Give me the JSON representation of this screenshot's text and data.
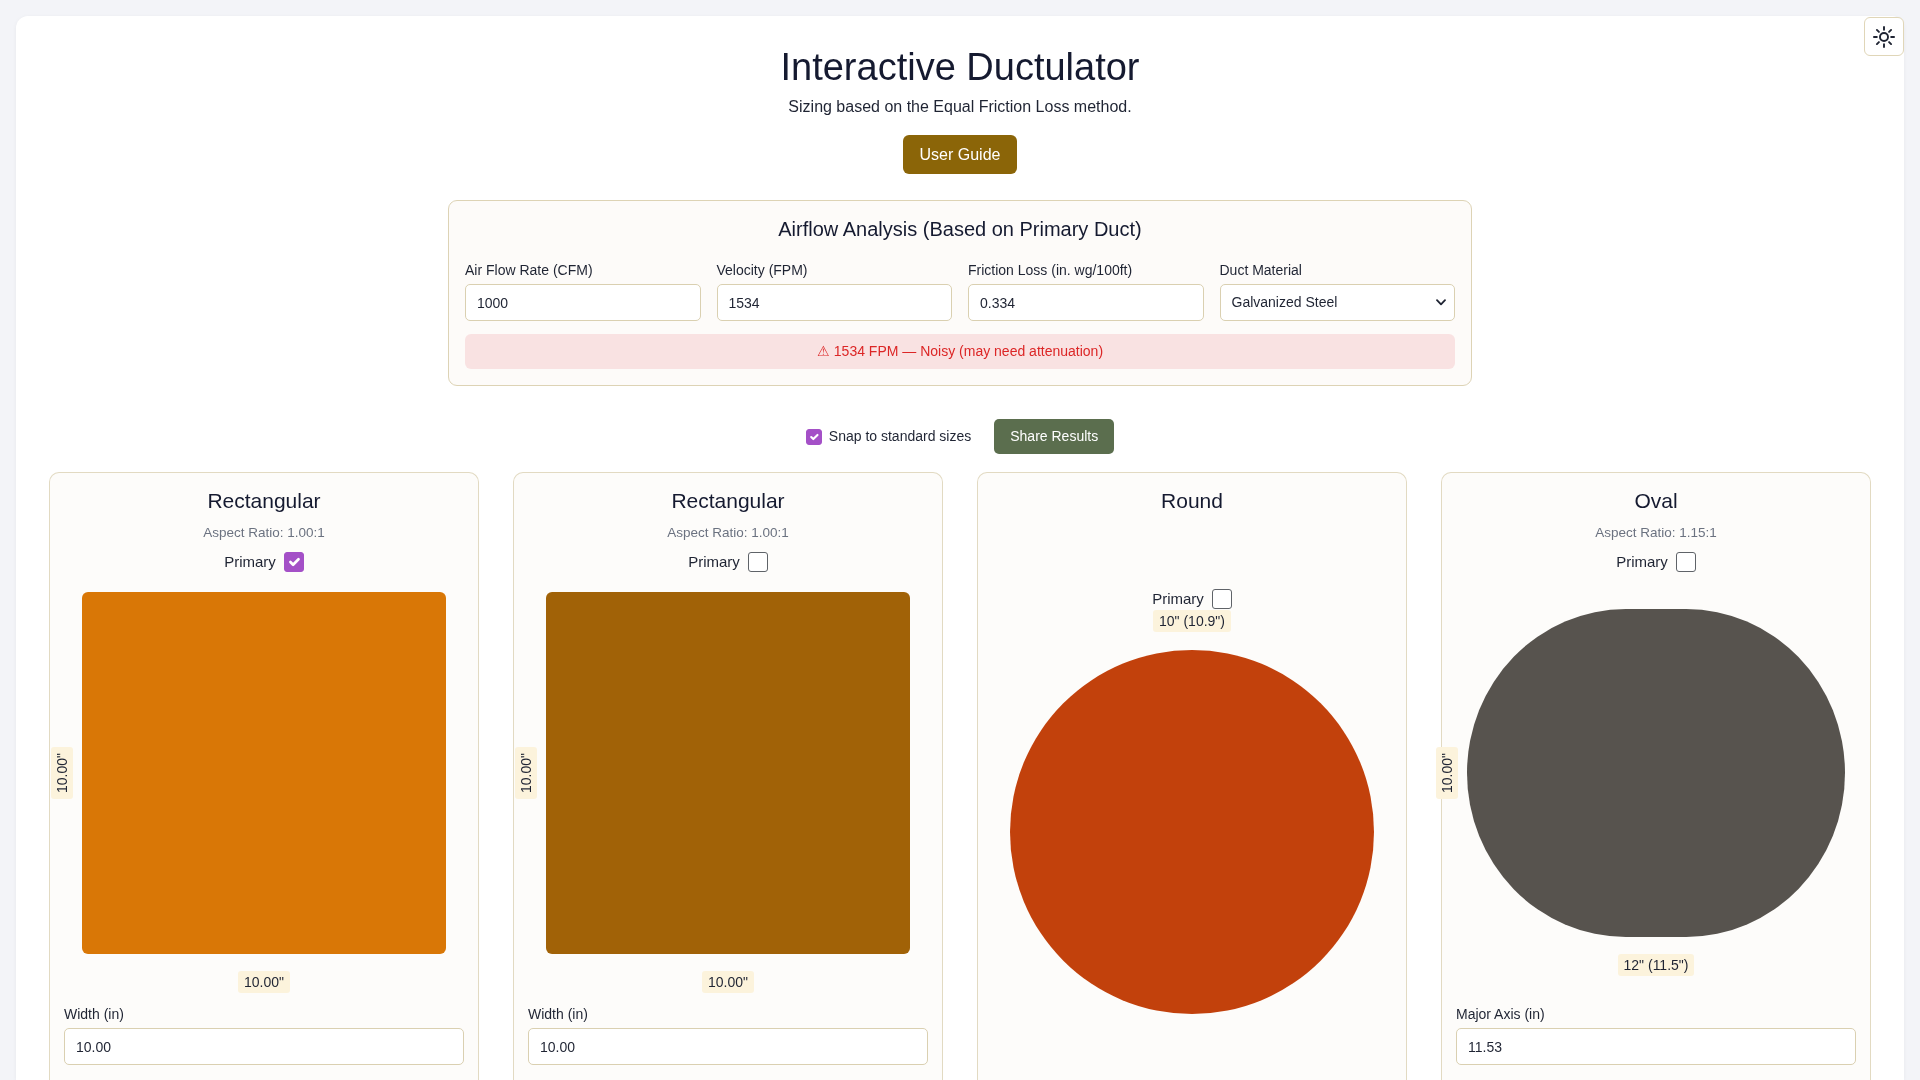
{
  "header": {
    "title": "Interactive Ductulator",
    "subtitle": "Sizing based on the Equal Friction Loss method.",
    "guide_button": "User Guide"
  },
  "analysis": {
    "title": "Airflow Analysis (Based on Primary Duct)",
    "fields": [
      {
        "kind": "input",
        "label": "Air Flow Rate (CFM)",
        "value": "1000"
      },
      {
        "kind": "input",
        "label": "Velocity (FPM)",
        "value": "1534"
      },
      {
        "kind": "input",
        "label": "Friction Loss (in. wg/100ft)",
        "value": "0.334"
      },
      {
        "kind": "select",
        "label": "Duct Material",
        "value": "Galvanized Steel"
      }
    ],
    "alert": {
      "text": "⚠ 1534 FPM — Noisy (may need attenuation)"
    }
  },
  "options": {
    "snap": {
      "label": "Snap to standard sizes",
      "checked": true
    },
    "share_button": "Share Results"
  },
  "ducts": [
    {
      "kind": "rectangular",
      "title": "Rectangular",
      "aspect_ratio": "Aspect Ratio: 1.00:1",
      "primary": {
        "label": "Primary",
        "checked": true
      },
      "color": "#d97706",
      "height_label": "10.00\"",
      "width_label": "10.00\"",
      "field": {
        "label": "Width (in)",
        "value": "10.00"
      }
    },
    {
      "kind": "rectangular",
      "title": "Rectangular",
      "aspect_ratio": "Aspect Ratio: 1.00:1",
      "primary": {
        "label": "Primary",
        "checked": false
      },
      "color": "#a16207",
      "height_label": "10.00\"",
      "width_label": "10.00\"",
      "field": {
        "label": "Width (in)",
        "value": "10.00"
      }
    },
    {
      "kind": "round",
      "title": "Round",
      "primary": {
        "label": "Primary",
        "checked": false
      },
      "color": "#c2410c",
      "diameter_label": "10\" (10.9\")"
    },
    {
      "kind": "oval",
      "title": "Oval",
      "aspect_ratio": "Aspect Ratio: 1.15:1",
      "primary": {
        "label": "Primary",
        "checked": false
      },
      "color": "#57534e",
      "height_label": "10.00\"",
      "width_label": "12\" (11.5\")",
      "field": {
        "label": "Major Axis (in)",
        "value": "11.53"
      }
    }
  ]
}
